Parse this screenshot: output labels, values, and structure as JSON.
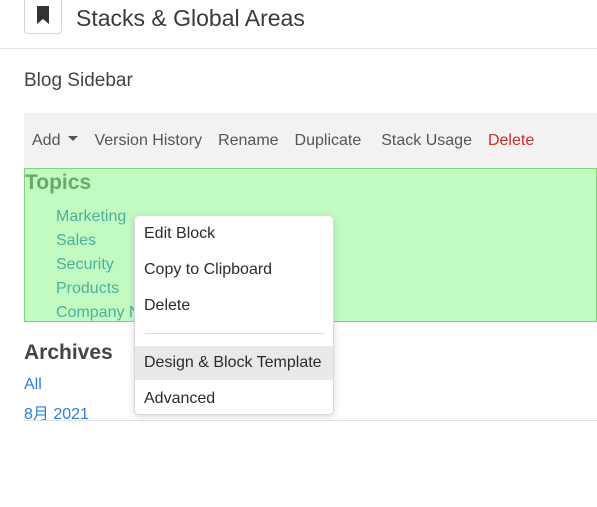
{
  "header": {
    "title": "Stacks & Global Areas",
    "icon": "bookmark-icon"
  },
  "stack": {
    "name": "Blog Sidebar"
  },
  "toolbar": {
    "add_label": "Add",
    "version_history_label": "Version History",
    "rename_label": "Rename",
    "duplicate_label": "Duplicate",
    "stack_usage_label": "Stack Usage",
    "delete_label": "Delete",
    "delete_color": "#c9302c"
  },
  "topics": {
    "title": "Topics",
    "items": [
      "Marketing",
      "Sales",
      "Security",
      "Products",
      "Company N"
    ],
    "highlight_color": "#c2fbc2"
  },
  "archives": {
    "title": "Archives",
    "items": [
      "All",
      "8月 2021"
    ]
  },
  "context_menu": {
    "items": [
      {
        "label": "Edit Block"
      },
      {
        "label": "Copy to Clipboard"
      },
      {
        "label": "Delete"
      },
      {
        "label": "Design & Block Template",
        "active": true
      },
      {
        "label": "Advanced"
      }
    ]
  }
}
